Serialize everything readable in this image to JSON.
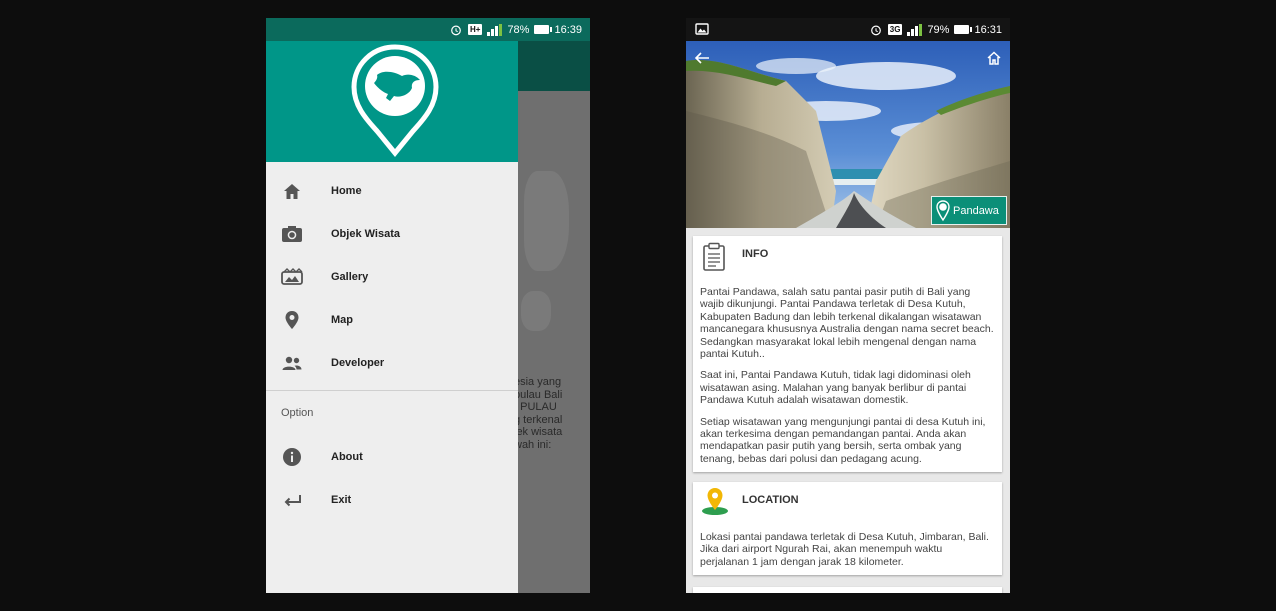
{
  "left_phone": {
    "status": {
      "network": "H+",
      "battery": "78%",
      "time": "16:39"
    },
    "drawer": {
      "menu": [
        {
          "icon": "home-icon",
          "label": "Home"
        },
        {
          "icon": "camera-icon",
          "label": "Objek Wisata"
        },
        {
          "icon": "gallery-icon",
          "label": "Gallery"
        },
        {
          "icon": "map-pin-icon",
          "label": "Map"
        },
        {
          "icon": "people-icon",
          "label": "Developer"
        }
      ],
      "section_label": "Option",
      "options": [
        {
          "icon": "info-icon",
          "label": "About"
        },
        {
          "icon": "exit-icon",
          "label": "Exit"
        }
      ]
    },
    "background_text": "esia yang\n pulau Bali\n, PULAU\ng terkenal\njek wisata\nwah ini:",
    "colors": {
      "header": "#009688",
      "drawer_bg": "#eeeeee"
    }
  },
  "right_phone": {
    "status": {
      "network": "3G",
      "battery": "79%",
      "time": "16:31"
    },
    "hero_logo_text": "Pandawa",
    "info_card": {
      "title": "INFO",
      "paragraphs": [
        "Pantai Pandawa, salah satu pantai pasir putih di Bali yang wajib dikunjungi. Pantai Pandawa terletak di Desa Kutuh, Kabupaten Badung dan lebih terkenal dikalangan wisatawan mancanegara khususnya Australia dengan nama secret beach. Sedangkan masyarakat lokal lebih mengenal dengan nama pantai Kutuh..",
        "Saat ini, Pantai Pandawa Kutuh, tidak lagi didominasi oleh wisatawan asing. Malahan yang banyak berlibur di pantai Pandawa Kutuh adalah wisatawan domestik.",
        "Setiap wisatawan yang mengunjungi pantai di desa Kutuh ini, akan terkesima dengan pemandangan pantai. Anda akan mendapatkan pasir putih yang bersih, serta ombak yang tenang, bebas dari polusi dan pedagang acung."
      ]
    },
    "location_card": {
      "title": "LOCATION",
      "text": "Lokasi pantai pandawa terletak di Desa Kutuh, Jimbaran, Bali. Jika dari airport Ngurah Rai, akan menempuh waktu perjalanan 1 jam dengan jarak 18 kilometer."
    }
  }
}
